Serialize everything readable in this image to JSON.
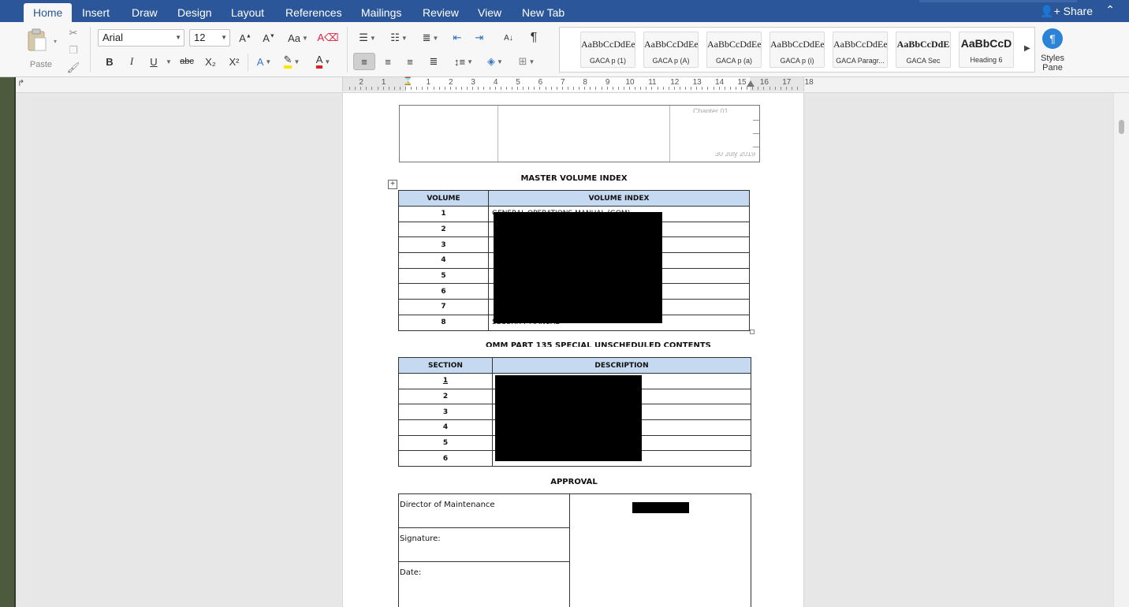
{
  "ribbon_tabs": [
    "Home",
    "Insert",
    "Draw",
    "Design",
    "Layout",
    "References",
    "Mailings",
    "Review",
    "View",
    "New Tab"
  ],
  "active_tab": "Home",
  "share_label": "Share",
  "clipboard": {
    "paste_label": "Paste"
  },
  "font": {
    "name": "Arial",
    "size": "12"
  },
  "format_buttons": {
    "bold": "B",
    "italic": "I",
    "underline": "U",
    "strike": "abc",
    "subscript": "X₂",
    "superscript": "X²"
  },
  "styles": [
    {
      "sample": "AaBbCcDdEe",
      "name": "GACA p (1)"
    },
    {
      "sample": "AaBbCcDdEe",
      "name": "GACA p (A)"
    },
    {
      "sample": "AaBbCcDdEe",
      "name": "GACA p (a)"
    },
    {
      "sample": "AaBbCcDdEe",
      "name": "GACA p (i)"
    },
    {
      "sample": "AaBbCcDdEe",
      "name": "GACA Paragr..."
    },
    {
      "sample": "AaBbCcDdE",
      "name": "GACA Sec"
    },
    {
      "sample": "AaBbCcD",
      "name": "Heading 6"
    }
  ],
  "styles_pane_label": "Styles Pane",
  "ruler_numbers": [
    "2",
    "1",
    "1",
    "2",
    "3",
    "4",
    "5",
    "6",
    "7",
    "8",
    "9",
    "10",
    "11",
    "12",
    "13",
    "14",
    "15",
    "16",
    "17",
    "18"
  ],
  "document": {
    "header_faint_top": "Chapter 01",
    "header_faint_bottom": "30 July 2019",
    "master_title": "MASTER VOLUME INDEX",
    "volume_table": {
      "headers": [
        "VOLUME",
        "VOLUME INDEX"
      ],
      "rows": [
        {
          "n": "1",
          "t": "GENERAL OPERATIONS MANUAL (GOM)"
        },
        {
          "n": "2",
          "t": ""
        },
        {
          "n": "3",
          "t": ""
        },
        {
          "n": "4",
          "t": ""
        },
        {
          "n": "5",
          "t": ""
        },
        {
          "n": "6",
          "t": ""
        },
        {
          "n": "7",
          "t": ""
        },
        {
          "n": "8",
          "t": "SECURITY MANUAL"
        }
      ]
    },
    "sub_title": "OMM PART 135 SPECIAL UNSCHEDULED CONTENTS",
    "section_table": {
      "headers": [
        "SECTION",
        "DESCRIPTION"
      ],
      "rows": [
        {
          "n": "1"
        },
        {
          "n": "2"
        },
        {
          "n": "3"
        },
        {
          "n": "4"
        },
        {
          "n": "5"
        },
        {
          "n": "6"
        }
      ]
    },
    "approval_title": "APPROVAL",
    "approval": {
      "role": "Director of Maintenance",
      "signature": "Signature:",
      "date": "Date:"
    }
  }
}
